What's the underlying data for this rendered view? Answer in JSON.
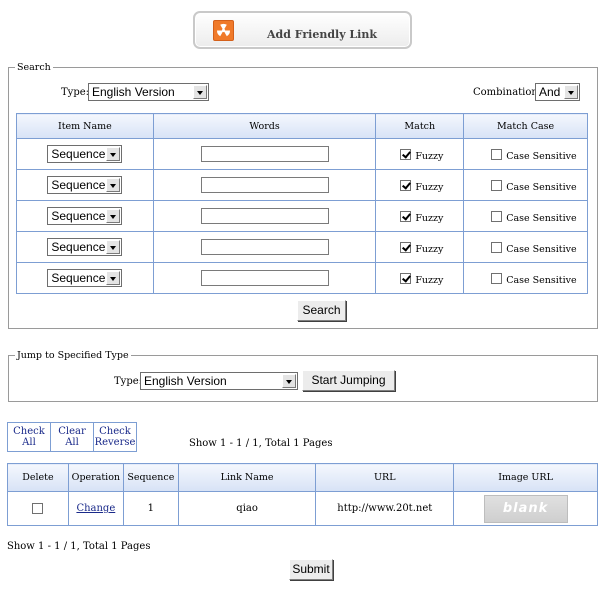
{
  "header": {
    "button_label": "Add Friendly Link",
    "icon": "radiation-icon",
    "accent": "#f07a2a"
  },
  "search": {
    "legend": "Search",
    "type_label": "Type:",
    "type_value": "English Version",
    "combination_label": "Combination:",
    "combination_value": "And",
    "columns": [
      "Item Name",
      "Words",
      "Match",
      "Match Case"
    ],
    "rows": [
      {
        "item": "Sequence",
        "words": "",
        "fuzzy_checked": true,
        "fuzzy_label": "Fuzzy",
        "case_checked": false,
        "case_label": "Case Sensitive"
      },
      {
        "item": "Sequence",
        "words": "",
        "fuzzy_checked": true,
        "fuzzy_label": "Fuzzy",
        "case_checked": false,
        "case_label": "Case Sensitive"
      },
      {
        "item": "Sequence",
        "words": "",
        "fuzzy_checked": true,
        "fuzzy_label": "Fuzzy",
        "case_checked": false,
        "case_label": "Case Sensitive"
      },
      {
        "item": "Sequence",
        "words": "",
        "fuzzy_checked": true,
        "fuzzy_label": "Fuzzy",
        "case_checked": false,
        "case_label": "Case Sensitive"
      },
      {
        "item": "Sequence",
        "words": "",
        "fuzzy_checked": true,
        "fuzzy_label": "Fuzzy",
        "case_checked": false,
        "case_label": "Case Sensitive"
      }
    ],
    "search_button": "Search"
  },
  "jump": {
    "legend": "Jump to Specified Type",
    "type_label": "Type:",
    "type_value": "English Version",
    "button": "Start Jumping"
  },
  "actions": {
    "check_all": [
      "Check",
      "All"
    ],
    "clear_all": "Clear All",
    "check_reverse": [
      "Check",
      "Reverse"
    ],
    "paging_top": "Show 1 - 1 / 1, Total 1 Pages"
  },
  "list": {
    "columns": [
      "Delete",
      "Operation",
      "Sequence",
      "Link Name",
      "URL",
      "Image URL"
    ],
    "rows": [
      {
        "delete_checked": false,
        "operation": "Change",
        "sequence": "1",
        "link_name": "qiao",
        "url": "http://www.20t.net",
        "image_text": "blank"
      }
    ]
  },
  "footer": {
    "paging_bottom": "Show 1 - 1 / 1, Total 1 Pages",
    "submit": "Submit"
  },
  "colors": {
    "grid_border": "#7d9ed3",
    "header_bg": "#dce6f6",
    "link": "#1a2a8a"
  }
}
